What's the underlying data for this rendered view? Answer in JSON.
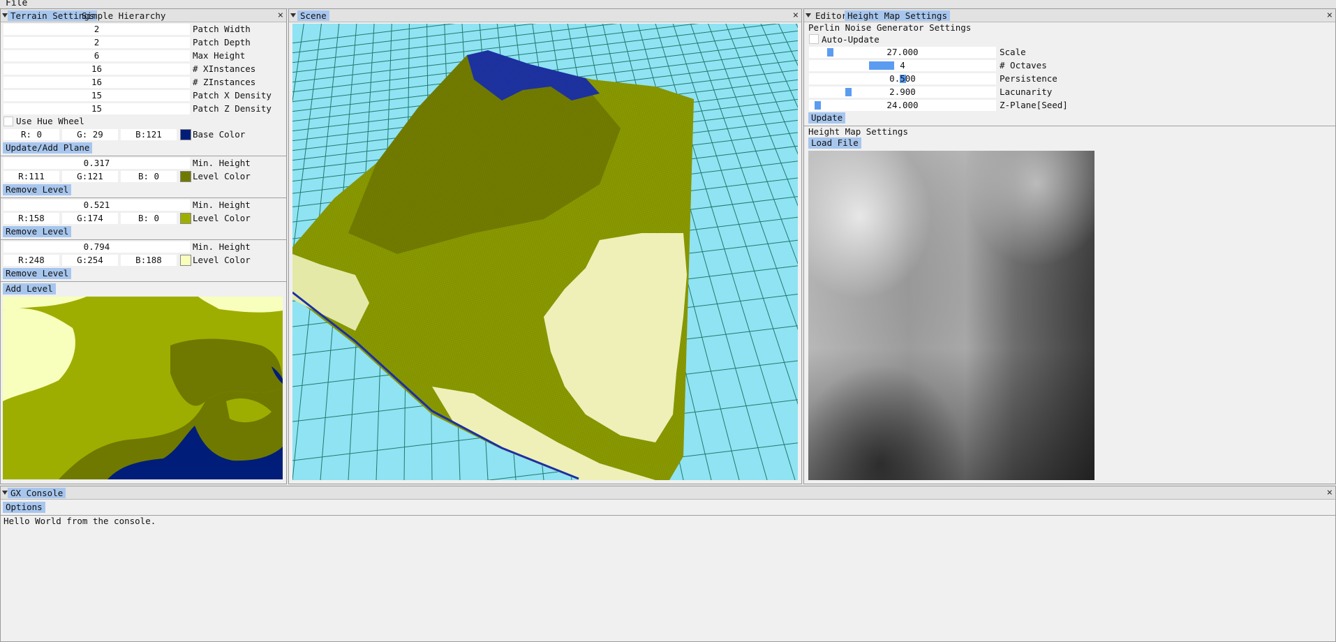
{
  "menubar": {
    "file": "File"
  },
  "terrain_panel": {
    "tabs": [
      "Terrain Settings",
      "Simple Hierarchy"
    ],
    "fields": [
      {
        "value": "2",
        "label": "Patch Width"
      },
      {
        "value": "2",
        "label": "Patch Depth"
      },
      {
        "value": "6",
        "label": "Max Height"
      },
      {
        "value": "16",
        "label": "# XInstances"
      },
      {
        "value": "16",
        "label": "# ZInstances"
      },
      {
        "value": "15",
        "label": "Patch X Density"
      },
      {
        "value": "15",
        "label": "Patch Z Density"
      }
    ],
    "hue_wheel_label": "Use Hue Wheel",
    "base_color": {
      "r": "R:  0",
      "g": "G: 29",
      "b": "B:121",
      "label": "Base Color",
      "hex": "#001d79"
    },
    "update_button": "Update/Add Plane",
    "levels": [
      {
        "min_height": "0.317",
        "min_label": "Min. Height",
        "r": "R:111",
        "g": "G:121",
        "b": "B:  0",
        "color_label": "Level Color",
        "hex": "#6f7900",
        "remove": "Remove Level"
      },
      {
        "min_height": "0.521",
        "min_label": "Min. Height",
        "r": "R:158",
        "g": "G:174",
        "b": "B:  0",
        "color_label": "Level Color",
        "hex": "#9eae00",
        "remove": "Remove Level"
      },
      {
        "min_height": "0.794",
        "min_label": "Min. Height",
        "r": "R:248",
        "g": "G:254",
        "b": "B:188",
        "color_label": "Level Color",
        "hex": "#f8febc",
        "remove": "Remove Level"
      }
    ],
    "add_level": "Add Level"
  },
  "scene_panel": {
    "tab": "Scene"
  },
  "editor_panel": {
    "tabs": [
      "Editor",
      "Height Map Settings"
    ],
    "perlin_title": "Perlin Noise Generator Settings",
    "auto_update": "Auto-Update",
    "sliders": [
      {
        "value": "27.000",
        "label": "Scale",
        "fraction": 0.1
      },
      {
        "value": "4",
        "label": "# Octaves",
        "fraction": 0.37
      },
      {
        "value": "0.500",
        "label": "Persistence",
        "fraction": 0.5
      },
      {
        "value": "2.900",
        "label": "Lacunarity",
        "fraction": 0.2
      },
      {
        "value": "24.000",
        "label": "Z-Plane[Seed]",
        "fraction": 0.03
      }
    ],
    "update_button": "Update",
    "height_map_title": "Height Map Settings",
    "load_file": "Load File"
  },
  "console_panel": {
    "tab": "GX Console",
    "options": "Options",
    "message": "Hello World from the console."
  },
  "colors": {
    "accent": "#a7c6ee",
    "slider": "#5b9cf0",
    "sky": "#8fe3f2",
    "grid": "#1f7a6e",
    "deep": "#001d79"
  }
}
